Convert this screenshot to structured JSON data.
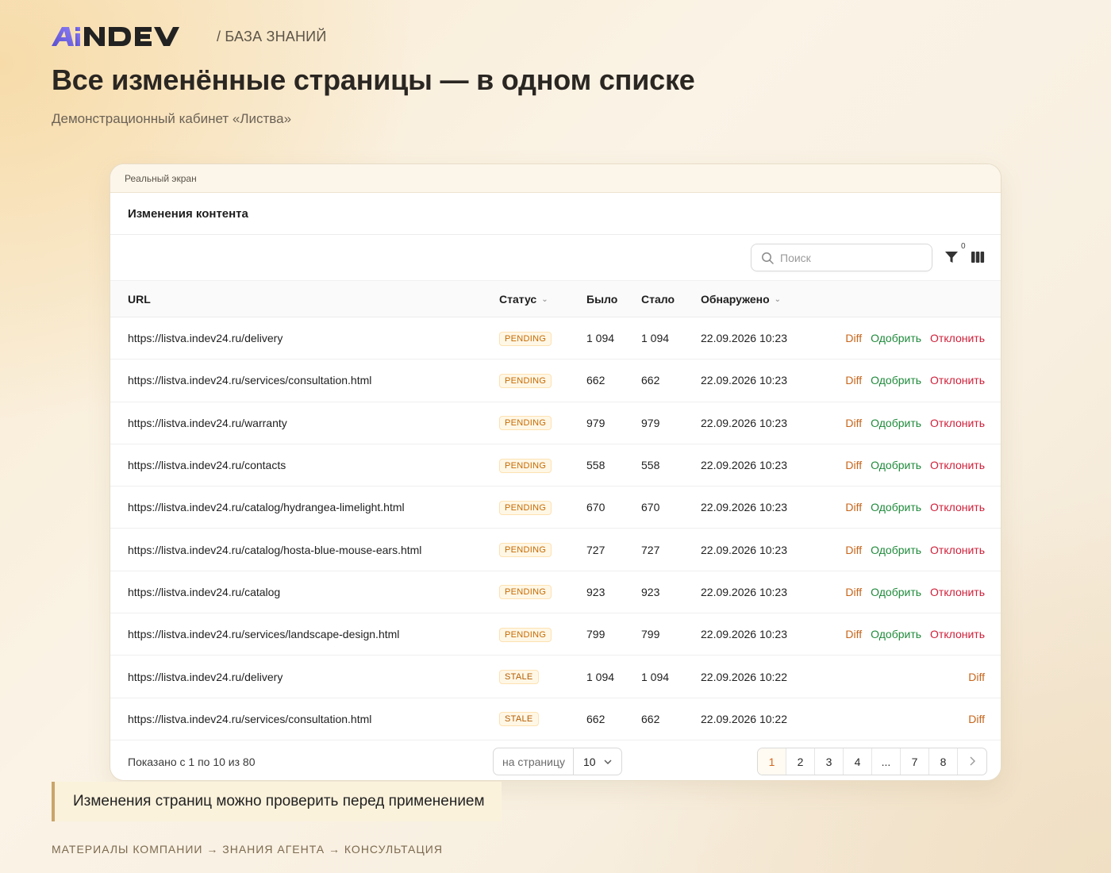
{
  "header": {
    "logo_text": "AiNDEV",
    "section": "/ БАЗА ЗНАНИЙ",
    "title": "Все изменённые страницы — в одном списке",
    "subtitle": "Демонстрационный кабинет «Листва»"
  },
  "card": {
    "label": "Реальный экран",
    "panel_title": "Изменения контента",
    "search_placeholder": "Поиск",
    "filter_count": "0",
    "columns": {
      "url": "URL",
      "status": "Статус",
      "before": "Было",
      "after": "Стало",
      "detected": "Обнаружено"
    },
    "rows": [
      {
        "url": "https://listva.indev24.ru/delivery",
        "status": "PENDING",
        "before": "1 094",
        "after": "1 094",
        "detected": "22.09.2026 10:23",
        "diff": "Diff",
        "approve": "Одобрить",
        "reject": "Отклонить"
      },
      {
        "url": "https://listva.indev24.ru/services/consultation.html",
        "status": "PENDING",
        "before": "662",
        "after": "662",
        "detected": "22.09.2026 10:23",
        "diff": "Diff",
        "approve": "Одобрить",
        "reject": "Отклонить"
      },
      {
        "url": "https://listva.indev24.ru/warranty",
        "status": "PENDING",
        "before": "979",
        "after": "979",
        "detected": "22.09.2026 10:23",
        "diff": "Diff",
        "approve": "Одобрить",
        "reject": "Отклонить"
      },
      {
        "url": "https://listva.indev24.ru/contacts",
        "status": "PENDING",
        "before": "558",
        "after": "558",
        "detected": "22.09.2026 10:23",
        "diff": "Diff",
        "approve": "Одобрить",
        "reject": "Отклонить"
      },
      {
        "url": "https://listva.indev24.ru/catalog/hydrangea-limelight.html",
        "status": "PENDING",
        "before": "670",
        "after": "670",
        "detected": "22.09.2026 10:23",
        "diff": "Diff",
        "approve": "Одобрить",
        "reject": "Отклонить"
      },
      {
        "url": "https://listva.indev24.ru/catalog/hosta-blue-mouse-ears.html",
        "status": "PENDING",
        "before": "727",
        "after": "727",
        "detected": "22.09.2026 10:23",
        "diff": "Diff",
        "approve": "Одобрить",
        "reject": "Отклонить"
      },
      {
        "url": "https://listva.indev24.ru/catalog",
        "status": "PENDING",
        "before": "923",
        "after": "923",
        "detected": "22.09.2026 10:23",
        "diff": "Diff",
        "approve": "Одобрить",
        "reject": "Отклонить"
      },
      {
        "url": "https://listva.indev24.ru/services/landscape-design.html",
        "status": "PENDING",
        "before": "799",
        "after": "799",
        "detected": "22.09.2026 10:23",
        "diff": "Diff",
        "approve": "Одобрить",
        "reject": "Отклонить"
      },
      {
        "url": "https://listva.indev24.ru/delivery",
        "status": "STALE",
        "before": "1 094",
        "after": "1 094",
        "detected": "22.09.2026 10:22",
        "diff": "Diff",
        "approve": "",
        "reject": ""
      },
      {
        "url": "https://listva.indev24.ru/services/consultation.html",
        "status": "STALE",
        "before": "662",
        "after": "662",
        "detected": "22.09.2026 10:22",
        "diff": "Diff",
        "approve": "",
        "reject": ""
      }
    ],
    "footer": {
      "shown": "Показано с 1 по 10 из 80",
      "per_page_label": "на страницу",
      "per_page_value": "10",
      "pages": [
        "1",
        "2",
        "3",
        "4",
        "...",
        "7",
        "8"
      ],
      "active_page": "1"
    }
  },
  "note": "Изменения страниц можно проверить перед применением",
  "bottom_crumbs": "МАТЕРИАЛЫ КОМПАНИИ → ЗНАНИЯ АГЕНТА → КОНСУЛЬТАЦИЯ",
  "colors": {
    "accent_orange": "#c7651b",
    "approve_green": "#1f8a3b",
    "reject_red": "#d0203a",
    "logo_purple": "#6c5ce7"
  },
  "icons": [
    "search-icon",
    "filter-icon",
    "columns-icon",
    "chevron-down-icon",
    "chevron-right-icon"
  ]
}
